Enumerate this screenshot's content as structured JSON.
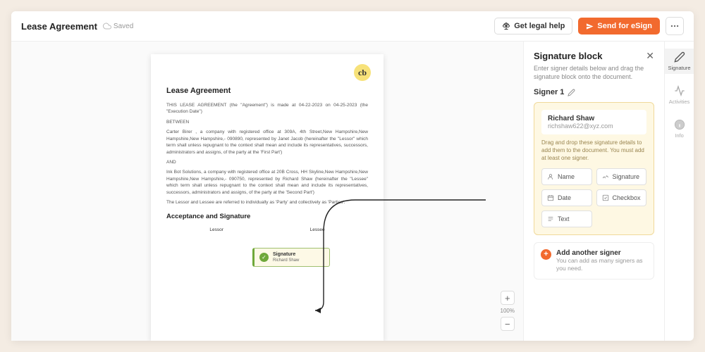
{
  "topbar": {
    "title": "Lease Agreement",
    "saved_label": "Saved",
    "legal_help": "Get legal help",
    "send_esign": "Send for eSign"
  },
  "document": {
    "heading": "Lease Agreement",
    "p1": "THIS LEASE AGREEMENT (the \"Agreement\") is made at 04-22-2023 on 04-25-2023 (the \"Execution Date\")",
    "between": "BETWEEN",
    "p2": "Carter Birer , a company with registered office at 309A, 4th Street,New Hampshire,New Hampshire,New Hampshire,- 090890, represented by Janet Jacob (hereinafter the \"Lessor\" which term shall unless repugnant to the context shall mean and include its representatives, successors, administrators and assigns, of the party at the 'First Part')",
    "and": "AND",
    "p3": "Ink Bot Solutions, a company with registered office at 20B Cross, HH Skyline,New Hampshire,New Hampshire,New Hampshire,- 090750, represented by Richard Shaw (hereinafter the \"Lessee\" which term shall unless repugnant to the context shall mean and include its representatives, successors, administrators and assigns, of the party at the 'Second Part')",
    "p4": "The Lessor and Lessee are referred to individually as 'Party' and collectively as 'Parties'.",
    "heading2": "Acceptance and Signature",
    "col_lessor": "Lessor",
    "col_lessee": "Lessee",
    "sig_label": "Signature",
    "sig_name": "Richard Shaw"
  },
  "zoom": {
    "level": "100%"
  },
  "panel": {
    "title": "Signature block",
    "desc": "Enter signer details below and drag the signature block onto the document.",
    "signer_label": "Signer 1",
    "signer_name": "Richard Shaw",
    "signer_email": "richshaw622@xyz.com",
    "help": "Drag and drop these signature details to add them to the document. You must add at least one signer.",
    "fields": {
      "name": "Name",
      "signature": "Signature",
      "date": "Date",
      "checkbox": "Checkbox",
      "text": "Text"
    },
    "add_title": "Add another signer",
    "add_desc": "You can add as many signers as you need."
  },
  "rail": {
    "signature": "Signature",
    "activities": "Activities",
    "info": "Info"
  }
}
